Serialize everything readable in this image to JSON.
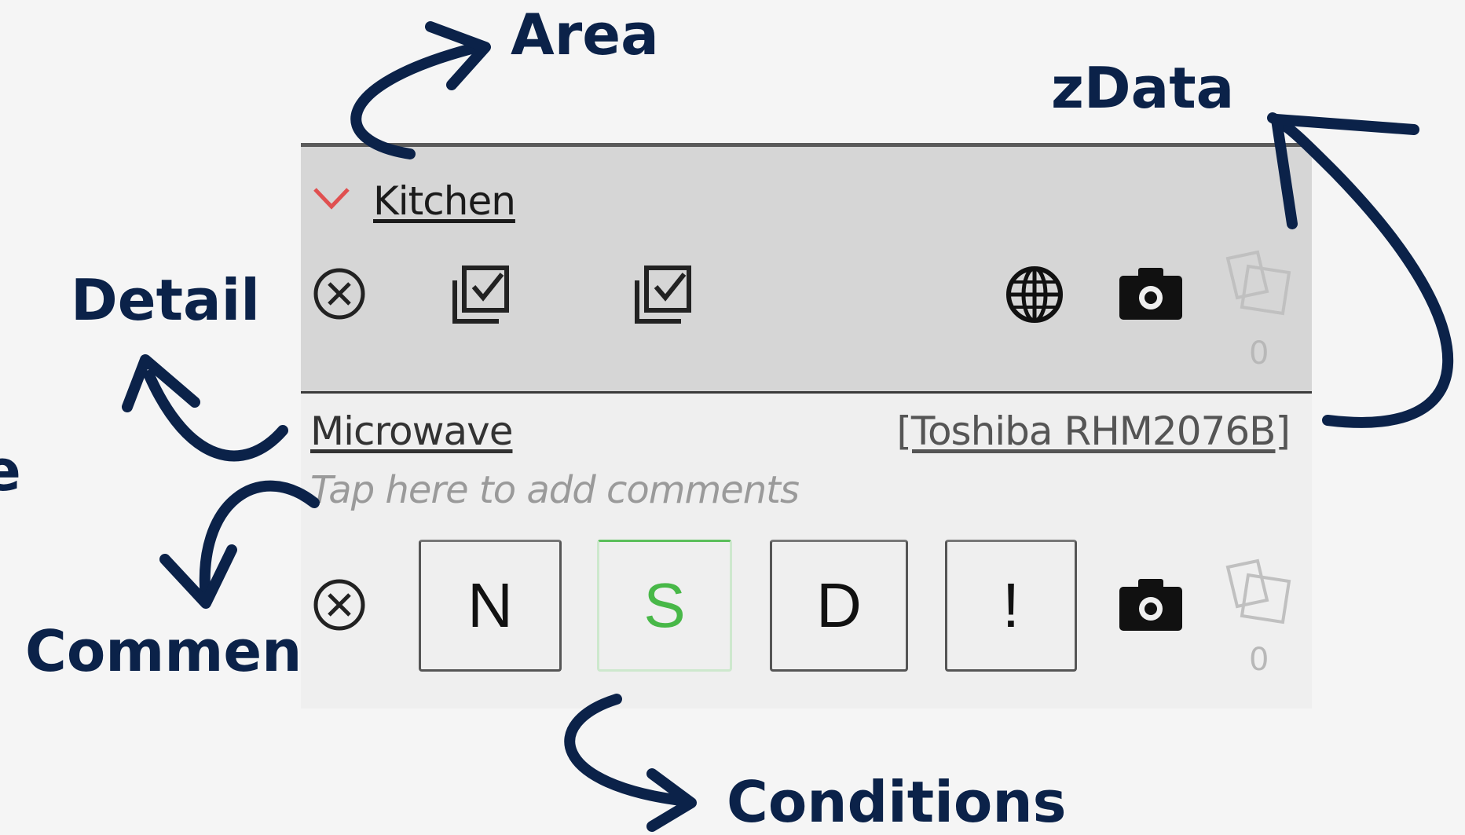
{
  "annotations": {
    "area": "Area",
    "zdata": "zData",
    "detail": "Detail",
    "comment": "Comment",
    "conditions": "Conditions",
    "partial_left": "e"
  },
  "area": {
    "title": "Kitchen",
    "photo_count": "0"
  },
  "detail": {
    "name": "Microwave",
    "model": "[Toshiba RHM2076B]",
    "comment_placeholder": "Tap here to add comments",
    "conditions": [
      "N",
      "S",
      "D",
      "!"
    ],
    "selected_condition": "S",
    "photo_count": "0"
  },
  "colors": {
    "annotation": "#0b2249",
    "chevron": "#e05050",
    "selected_condition": "#48b848"
  },
  "icons": {
    "area_row": [
      "close-circle-icon",
      "checklist-icon",
      "checklist-icon",
      "globe-icon",
      "camera-icon",
      "photo-stack-icon"
    ],
    "detail_row": [
      "close-circle-icon",
      "camera-icon",
      "photo-stack-icon"
    ],
    "area_toggle": "chevron-down-icon"
  }
}
